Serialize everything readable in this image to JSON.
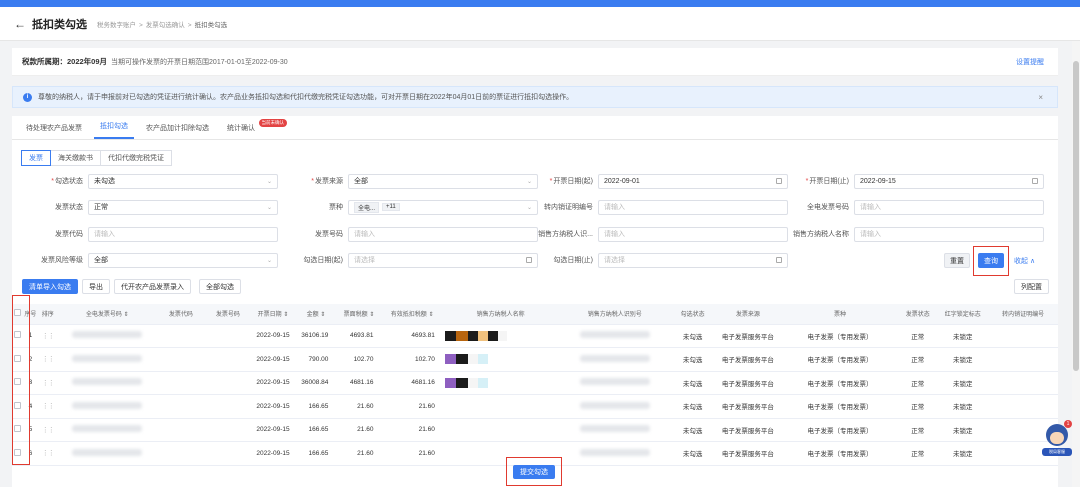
{
  "header": {
    "back_icon": "arrow-left-icon",
    "title": "抵扣类勾选",
    "breadcrumb": [
      "税务数字账户",
      "发票勾选确认",
      "抵扣类勾选"
    ]
  },
  "period": {
    "label": "税款所属期：2022年09月",
    "hint": "当期可操作发票的开票日期范围2017-01-01至2022-09-30",
    "settings_link": "设置提醒"
  },
  "notice": {
    "text": "尊敬的纳税人，请于申报前对已勾选的凭证进行统计确认。农产品业务抵扣勾选和代扣代缴完税凭证勾选功能，可对开票日期在2022年04月01日前的票证进行抵扣勾选操作。",
    "close": "×"
  },
  "tabs": [
    {
      "label": "待处理农产品发票",
      "active": false
    },
    {
      "label": "抵扣勾选",
      "active": true
    },
    {
      "label": "农产品加计扣除勾选",
      "active": false
    },
    {
      "label": "统计确认",
      "active": false,
      "badge": "当前未确认"
    }
  ],
  "subtabs": [
    {
      "label": "发票",
      "active": true
    },
    {
      "label": "海关缴款书",
      "active": false
    },
    {
      "label": "代扣代缴完税凭证",
      "active": false
    }
  ],
  "filters": {
    "status": {
      "label": "勾选状态",
      "value": "未勾选"
    },
    "source": {
      "label": "发票来源",
      "value": "全部"
    },
    "date_start": {
      "label": "开票日期(起)",
      "value": "2022-09-01"
    },
    "date_end": {
      "label": "开票日期(止)",
      "value": "2022-09-15"
    },
    "invoice_status": {
      "label": "发票状态",
      "value": "正常"
    },
    "ticket_type": {
      "label": "票种",
      "value": "全电...",
      "extra": "+11"
    },
    "transfer_no": {
      "label": "转内销证明编号",
      "placeholder": "请输入"
    },
    "full_no": {
      "label": "全电发票号码",
      "placeholder": "请输入"
    },
    "code": {
      "label": "发票代码",
      "placeholder": "请输入"
    },
    "number": {
      "label": "发票号码",
      "placeholder": "请输入"
    },
    "seller_id": {
      "label": "销售方纳税人识...",
      "placeholder": "请输入"
    },
    "seller_name": {
      "label": "销售方纳税人名称",
      "placeholder": "请输入"
    },
    "risk": {
      "label": "发票风险等级",
      "value": "全部"
    },
    "check_start": {
      "label": "勾选日期(起)",
      "placeholder": "请选择"
    },
    "check_end": {
      "label": "勾选日期(止)",
      "placeholder": "请选择"
    }
  },
  "actions": {
    "reset": "重置",
    "search": "查询",
    "collapse": "收起 ∧",
    "import": "清单导入勾选",
    "export": "导出",
    "agri_entry": "代开农产品发票录入",
    "select_all": "全部勾选",
    "columns": "列配置",
    "submit": "提交勾选"
  },
  "table": {
    "columns": [
      "序号",
      "排序",
      "全电发票号码 ⇕",
      "发票代码",
      "发票号码",
      "开票日期 ⇕",
      "金额 ⇕",
      "票面税额 ⇕",
      "有效抵扣税额 ⇕",
      "销售方纳税人名称",
      "销售方纳税人识别号",
      "勾选状态",
      "发票来源",
      "票种",
      "发票状态",
      "红字锁定标志",
      "转内销证明编号"
    ],
    "rows": [
      {
        "idx": "1",
        "date": "2022-09-15",
        "amount": "36106.19",
        "tax": "4693.81",
        "valid_tax": "4693.81",
        "state": "未勾选",
        "source": "电子发票服务平台",
        "type": "电子发票（专用发票）",
        "inv_status": "正常",
        "red_lock": "未锁定",
        "seller_colors": [
          "#1b1b1b",
          "#b8650f",
          "#1b1b1b",
          "#f0c17e",
          "#1b1b1b",
          "#f5f5f5"
        ]
      },
      {
        "idx": "2",
        "date": "2022-09-15",
        "amount": "790.00",
        "tax": "102.70",
        "valid_tax": "102.70",
        "state": "未勾选",
        "source": "电子发票服务平台",
        "type": "电子发票（专用发票）",
        "inv_status": "正常",
        "red_lock": "未锁定",
        "seller_colors": [
          "#8e5fc0",
          "#1b1b1b",
          "#f5f5f5",
          "#d6f0f7"
        ]
      },
      {
        "idx": "3",
        "date": "2022-09-15",
        "amount": "36008.84",
        "tax": "4681.16",
        "valid_tax": "4681.16",
        "state": "未勾选",
        "source": "电子发票服务平台",
        "type": "电子发票（专用发票）",
        "inv_status": "正常",
        "red_lock": "未锁定",
        "seller_colors": [
          "#8e5fc0",
          "#1b1b1b",
          "#f5f5f5",
          "#d6f0f7"
        ]
      },
      {
        "idx": "4",
        "date": "2022-09-15",
        "amount": "166.65",
        "tax": "21.60",
        "valid_tax": "21.60",
        "state": "未勾选",
        "source": "电子发票服务平台",
        "type": "电子发票（专用发票）",
        "inv_status": "正常",
        "red_lock": "未锁定",
        "seller_colors": []
      },
      {
        "idx": "5",
        "date": "2022-09-15",
        "amount": "166.65",
        "tax": "21.60",
        "valid_tax": "21.60",
        "state": "未勾选",
        "source": "电子发票服务平台",
        "type": "电子发票（专用发票）",
        "inv_status": "正常",
        "red_lock": "未锁定",
        "seller_colors": []
      },
      {
        "idx": "6",
        "date": "2022-09-15",
        "amount": "166.65",
        "tax": "21.60",
        "valid_tax": "21.60",
        "state": "未勾选",
        "source": "电子发票服务平台",
        "type": "电子发票（专用发票）",
        "inv_status": "正常",
        "red_lock": "未锁定",
        "seller_colors": []
      }
    ]
  },
  "assistant": {
    "badge": "1",
    "label": "税局客服"
  }
}
